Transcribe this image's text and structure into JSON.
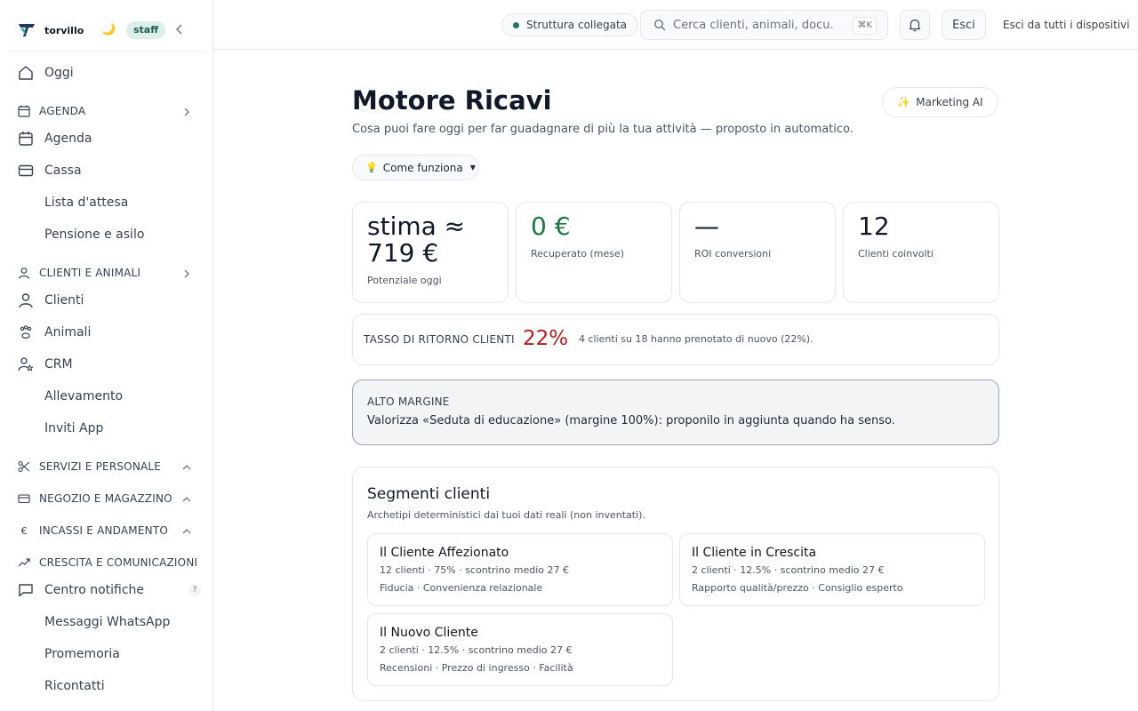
{
  "brand": {
    "name": "torvillo",
    "role_badge": "staff"
  },
  "sidebar": {
    "items": [
      {
        "label": "Oggi"
      },
      {
        "label": "AGENDA"
      },
      {
        "label": "Agenda"
      },
      {
        "label": "Cassa"
      },
      {
        "label": "Lista d'attesa"
      },
      {
        "label": "Pensione e asilo"
      },
      {
        "label": "CLIENTI E ANIMALI"
      },
      {
        "label": "Clienti"
      },
      {
        "label": "Animali"
      },
      {
        "label": "CRM"
      },
      {
        "label": "Allevamento"
      },
      {
        "label": "Inviti App"
      },
      {
        "label": "SERVIZI E PERSONALE"
      },
      {
        "label": "NEGOZIO E MAGAZZINO"
      },
      {
        "label": "INCASSI E ANDAMENTO"
      },
      {
        "label": "CRESCITA E COMUNICAZIONI"
      },
      {
        "label": "Centro notifiche",
        "badge": "?"
      },
      {
        "label": "Messaggi WhatsApp"
      },
      {
        "label": "Promemoria"
      },
      {
        "label": "Ricontatti"
      }
    ]
  },
  "topbar": {
    "status": "Struttura collegata",
    "search_placeholder": "Cerca clienti, animali, docu...",
    "search_shortcut": "⌘K",
    "logout": "Esci",
    "logout_all": "Esci da tutti i dispositivi"
  },
  "page": {
    "title": "Motore Ricavi",
    "subtitle": "Cosa puoi fare oggi per far guadagnare di più la tua attività — proposto in automatico.",
    "ai_button": "Marketing AI",
    "how_button": "Come funziona"
  },
  "stats": [
    {
      "value": "stima ≈ 719 €",
      "label": "Potenziale oggi"
    },
    {
      "value": "0 €",
      "label": "Recuperato (mese)"
    },
    {
      "value": "—",
      "label": "ROI conversioni"
    },
    {
      "value": "12",
      "label": "Clienti coinvolti"
    }
  ],
  "return_rate": {
    "label": "TASSO DI RITORNO CLIENTI",
    "value": "22%",
    "description": "4 clienti su 18 hanno prenotato di nuovo (22%)."
  },
  "high_margin": {
    "title": "ALTO MARGINE",
    "text": "Valorizza «Seduta di educazione» (margine 100%): proponilo in aggiunta quando ha senso."
  },
  "segments": {
    "title": "Segmenti clienti",
    "subtitle": "Archetipi deterministici dai tuoi dati reali (non inventati).",
    "items": [
      {
        "name": "Il Cliente Affezionato",
        "meta": "12 clienti · 75% · scontrino medio 27 €",
        "tags": "Fiducia · Convenienza relazionale"
      },
      {
        "name": "Il Cliente in Crescita",
        "meta": "2 clienti · 12.5% · scontrino medio 27 €",
        "tags": "Rapporto qualità/prezzo · Consiglio esperto"
      },
      {
        "name": "Il Nuovo Cliente",
        "meta": "2 clienti · 12.5% · scontrino medio 27 €",
        "tags": "Recensioni · Prezzo di ingresso · Facilità"
      }
    ]
  },
  "colors": {
    "accent_green": "#1a7a3e",
    "accent_red": "#b91c1c",
    "badge_bg": "#dcefe9",
    "status_dot": "#1f7a5a"
  }
}
